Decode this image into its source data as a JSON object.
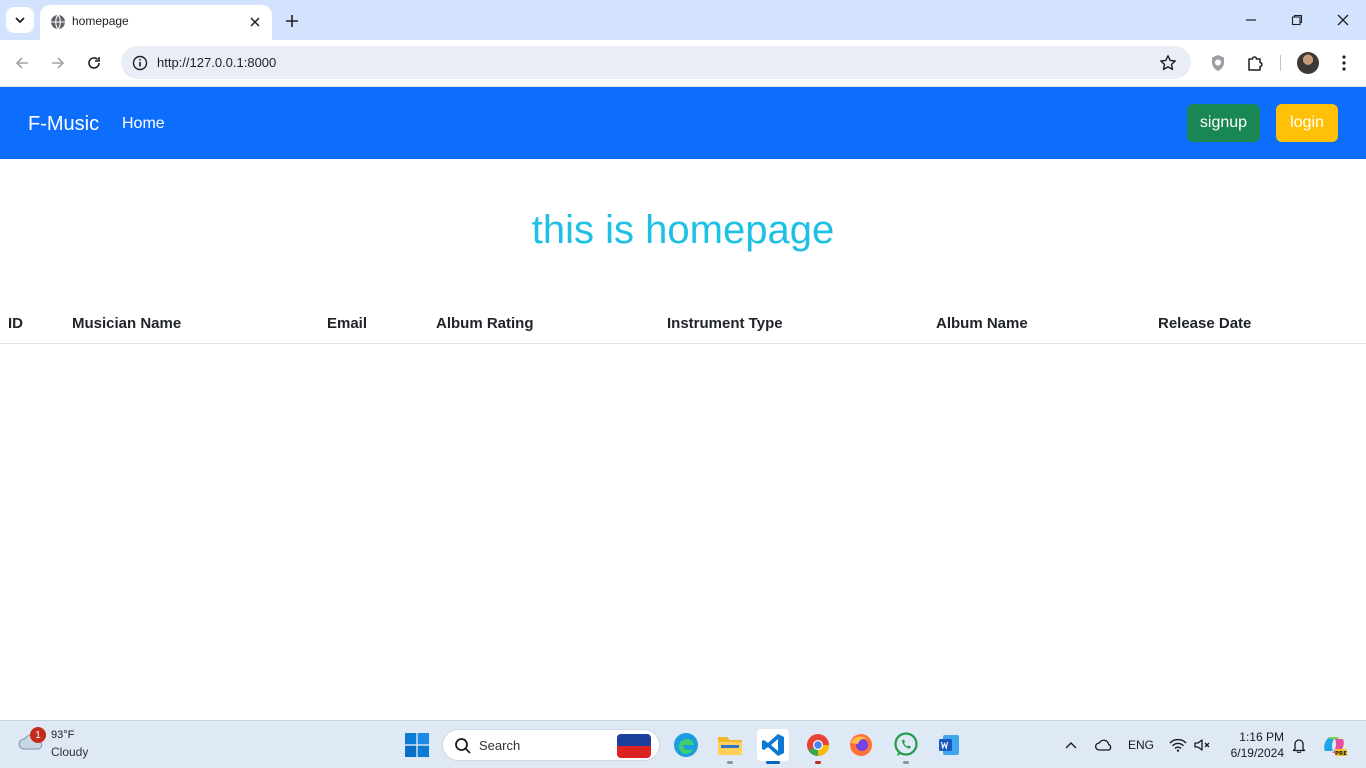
{
  "browser": {
    "tab_title": "homepage",
    "url": "http://127.0.0.1:8000"
  },
  "navbar": {
    "brand": "F-Music",
    "home_link": "Home",
    "signup_label": "signup",
    "login_label": "login"
  },
  "page": {
    "heading": "this is homepage",
    "table_headers": [
      "ID",
      "Musician Name",
      "Email",
      "Album Rating",
      "Instrument Type",
      "Album Name",
      "Release Date"
    ]
  },
  "taskbar": {
    "weather_badge": "1",
    "temperature": "93°F",
    "condition": "Cloudy",
    "search_placeholder": "Search",
    "language": "ENG",
    "time": "1:16 PM",
    "date": "6/19/2024"
  },
  "colors": {
    "navbar": "#0d6efd",
    "signup": "#198754",
    "login": "#ffc107",
    "heading": "#1ec1e6"
  }
}
